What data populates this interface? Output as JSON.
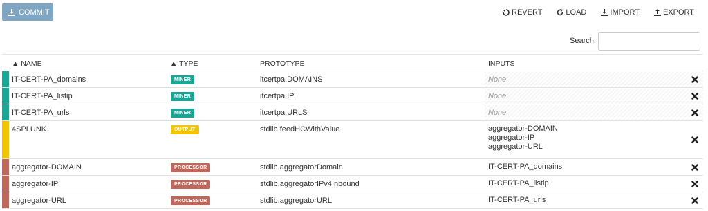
{
  "toolbar": {
    "commit_label": "COMMIT",
    "revert_label": "REVERT",
    "load_label": "LOAD",
    "import_label": "IMPORT",
    "export_label": "EXPORT"
  },
  "search": {
    "label": "Search:",
    "value": ""
  },
  "table": {
    "headers": {
      "name": "▲ NAME",
      "type": "▲ TYPE",
      "prototype": "PROTOTYPE",
      "inputs": "INPUTS"
    },
    "rows": [
      {
        "name": "IT-CERT-PA_domains",
        "type": "MINER",
        "prototype": "itcertpa.DOMAINS",
        "inputs": [
          "None"
        ],
        "inputs_none": true
      },
      {
        "name": "IT-CERT-PA_listip",
        "type": "MINER",
        "prototype": "itcertpa.IP",
        "inputs": [
          "None"
        ],
        "inputs_none": true
      },
      {
        "name": "IT-CERT-PA_urls",
        "type": "MINER",
        "prototype": "itcertpa.URLS",
        "inputs": [
          "None"
        ],
        "inputs_none": true
      },
      {
        "name": "4SPLUNK",
        "type": "OUTPUT",
        "prototype": "stdlib.feedHCWithValue",
        "inputs": [
          "aggregator-DOMAIN",
          "aggregator-IP",
          "aggregator-URL"
        ],
        "inputs_none": false
      },
      {
        "name": "aggregator-DOMAIN",
        "type": "PROCESSOR",
        "prototype": "stdlib.aggregatorDomain",
        "inputs": [
          "IT-CERT-PA_domains"
        ],
        "inputs_none": false
      },
      {
        "name": "aggregator-IP",
        "type": "PROCESSOR",
        "prototype": "stdlib.aggregatorIPv4Inbound",
        "inputs": [
          "IT-CERT-PA_listip"
        ],
        "inputs_none": false
      },
      {
        "name": "aggregator-URL",
        "type": "PROCESSOR",
        "prototype": "stdlib.aggregatorURL",
        "inputs": [
          "IT-CERT-PA_urls"
        ],
        "inputs_none": false
      }
    ]
  },
  "colors": {
    "MINER": "#1aa595",
    "OUTPUT": "#f2c500",
    "PROCESSOR": "#c0675b",
    "commit_button": "#7fa6c2"
  },
  "icons": {
    "commit": "download-icon",
    "revert": "revert-icon",
    "load": "refresh-icon",
    "import": "import-icon",
    "export": "export-icon",
    "delete": "close-icon"
  }
}
